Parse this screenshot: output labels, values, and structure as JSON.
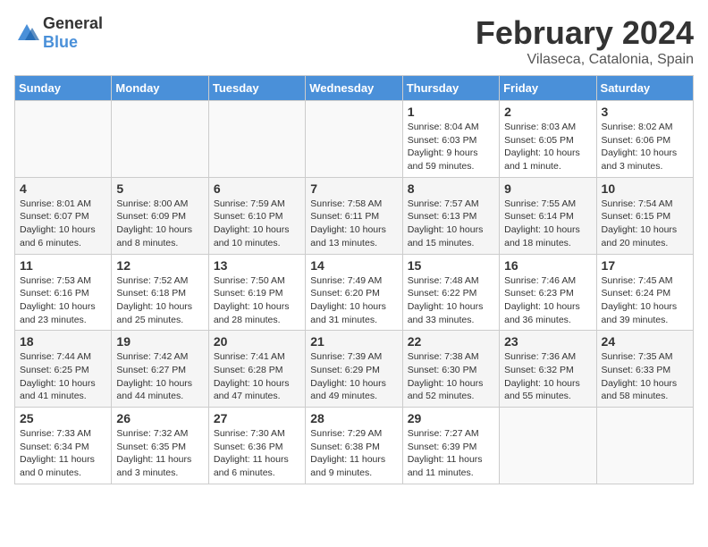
{
  "logo": {
    "text_general": "General",
    "text_blue": "Blue"
  },
  "title": "February 2024",
  "subtitle": "Vilaseca, Catalonia, Spain",
  "days_of_week": [
    "Sunday",
    "Monday",
    "Tuesday",
    "Wednesday",
    "Thursday",
    "Friday",
    "Saturday"
  ],
  "weeks": [
    [
      {
        "day": "",
        "info": ""
      },
      {
        "day": "",
        "info": ""
      },
      {
        "day": "",
        "info": ""
      },
      {
        "day": "",
        "info": ""
      },
      {
        "day": "1",
        "info": "Sunrise: 8:04 AM\nSunset: 6:03 PM\nDaylight: 9 hours\nand 59 minutes."
      },
      {
        "day": "2",
        "info": "Sunrise: 8:03 AM\nSunset: 6:05 PM\nDaylight: 10 hours\nand 1 minute."
      },
      {
        "day": "3",
        "info": "Sunrise: 8:02 AM\nSunset: 6:06 PM\nDaylight: 10 hours\nand 3 minutes."
      }
    ],
    [
      {
        "day": "4",
        "info": "Sunrise: 8:01 AM\nSunset: 6:07 PM\nDaylight: 10 hours\nand 6 minutes."
      },
      {
        "day": "5",
        "info": "Sunrise: 8:00 AM\nSunset: 6:09 PM\nDaylight: 10 hours\nand 8 minutes."
      },
      {
        "day": "6",
        "info": "Sunrise: 7:59 AM\nSunset: 6:10 PM\nDaylight: 10 hours\nand 10 minutes."
      },
      {
        "day": "7",
        "info": "Sunrise: 7:58 AM\nSunset: 6:11 PM\nDaylight: 10 hours\nand 13 minutes."
      },
      {
        "day": "8",
        "info": "Sunrise: 7:57 AM\nSunset: 6:13 PM\nDaylight: 10 hours\nand 15 minutes."
      },
      {
        "day": "9",
        "info": "Sunrise: 7:55 AM\nSunset: 6:14 PM\nDaylight: 10 hours\nand 18 minutes."
      },
      {
        "day": "10",
        "info": "Sunrise: 7:54 AM\nSunset: 6:15 PM\nDaylight: 10 hours\nand 20 minutes."
      }
    ],
    [
      {
        "day": "11",
        "info": "Sunrise: 7:53 AM\nSunset: 6:16 PM\nDaylight: 10 hours\nand 23 minutes."
      },
      {
        "day": "12",
        "info": "Sunrise: 7:52 AM\nSunset: 6:18 PM\nDaylight: 10 hours\nand 25 minutes."
      },
      {
        "day": "13",
        "info": "Sunrise: 7:50 AM\nSunset: 6:19 PM\nDaylight: 10 hours\nand 28 minutes."
      },
      {
        "day": "14",
        "info": "Sunrise: 7:49 AM\nSunset: 6:20 PM\nDaylight: 10 hours\nand 31 minutes."
      },
      {
        "day": "15",
        "info": "Sunrise: 7:48 AM\nSunset: 6:22 PM\nDaylight: 10 hours\nand 33 minutes."
      },
      {
        "day": "16",
        "info": "Sunrise: 7:46 AM\nSunset: 6:23 PM\nDaylight: 10 hours\nand 36 minutes."
      },
      {
        "day": "17",
        "info": "Sunrise: 7:45 AM\nSunset: 6:24 PM\nDaylight: 10 hours\nand 39 minutes."
      }
    ],
    [
      {
        "day": "18",
        "info": "Sunrise: 7:44 AM\nSunset: 6:25 PM\nDaylight: 10 hours\nand 41 minutes."
      },
      {
        "day": "19",
        "info": "Sunrise: 7:42 AM\nSunset: 6:27 PM\nDaylight: 10 hours\nand 44 minutes."
      },
      {
        "day": "20",
        "info": "Sunrise: 7:41 AM\nSunset: 6:28 PM\nDaylight: 10 hours\nand 47 minutes."
      },
      {
        "day": "21",
        "info": "Sunrise: 7:39 AM\nSunset: 6:29 PM\nDaylight: 10 hours\nand 49 minutes."
      },
      {
        "day": "22",
        "info": "Sunrise: 7:38 AM\nSunset: 6:30 PM\nDaylight: 10 hours\nand 52 minutes."
      },
      {
        "day": "23",
        "info": "Sunrise: 7:36 AM\nSunset: 6:32 PM\nDaylight: 10 hours\nand 55 minutes."
      },
      {
        "day": "24",
        "info": "Sunrise: 7:35 AM\nSunset: 6:33 PM\nDaylight: 10 hours\nand 58 minutes."
      }
    ],
    [
      {
        "day": "25",
        "info": "Sunrise: 7:33 AM\nSunset: 6:34 PM\nDaylight: 11 hours\nand 0 minutes."
      },
      {
        "day": "26",
        "info": "Sunrise: 7:32 AM\nSunset: 6:35 PM\nDaylight: 11 hours\nand 3 minutes."
      },
      {
        "day": "27",
        "info": "Sunrise: 7:30 AM\nSunset: 6:36 PM\nDaylight: 11 hours\nand 6 minutes."
      },
      {
        "day": "28",
        "info": "Sunrise: 7:29 AM\nSunset: 6:38 PM\nDaylight: 11 hours\nand 9 minutes."
      },
      {
        "day": "29",
        "info": "Sunrise: 7:27 AM\nSunset: 6:39 PM\nDaylight: 11 hours\nand 11 minutes."
      },
      {
        "day": "",
        "info": ""
      },
      {
        "day": "",
        "info": ""
      }
    ]
  ]
}
